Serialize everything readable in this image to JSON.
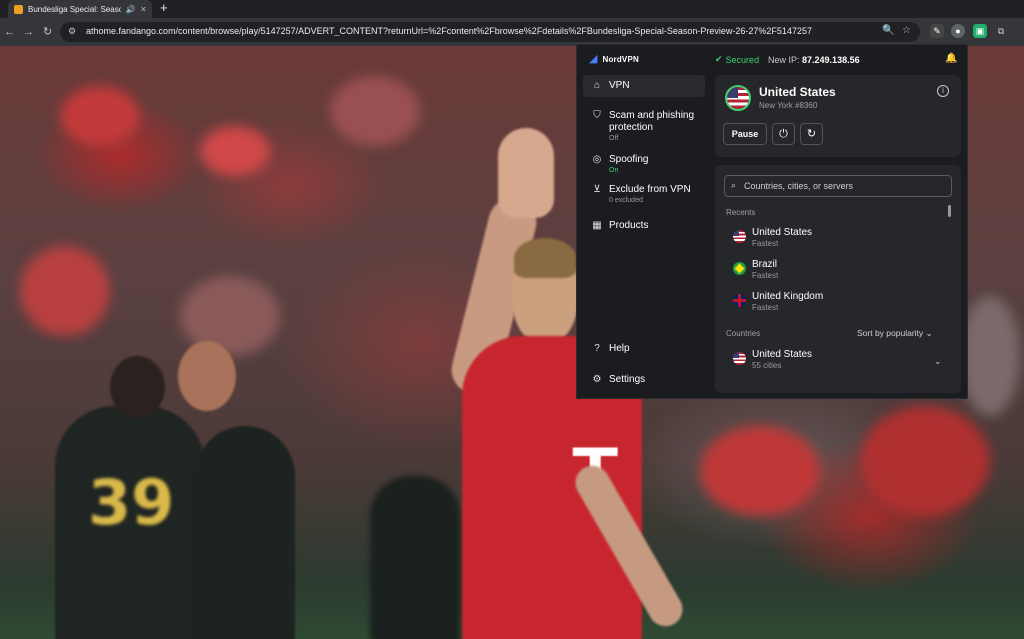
{
  "browser": {
    "tab_title": "Bundesliga Special: Season",
    "tab_audio_icon": "speaker-icon",
    "tab_close": "×",
    "new_tab": "+",
    "back": "←",
    "forward": "→",
    "reload": "↻",
    "url": "athome.fandango.com/content/browse/play/5147257/ADVERT_CONTENT?returnUrl=%2Fcontent%2Fbrowse%2Fdetails%2FBundesliga-Special-Season-Preview-26-27%2F5147257"
  },
  "vpn": {
    "logo_text": "NordVPN",
    "status": "Secured",
    "new_ip_label": "New IP:",
    "new_ip": "87.249.138.56",
    "nav": [
      {
        "label": "VPN",
        "sub": ""
      },
      {
        "label": "Scam and phishing protection",
        "sub": "Off"
      },
      {
        "label": "Spoofing",
        "sub": "On"
      },
      {
        "label": "Exclude from VPN",
        "sub": "0 excluded"
      },
      {
        "label": "Products",
        "sub": ""
      }
    ],
    "help": "Help",
    "settings": "Settings",
    "connection": {
      "country": "United States",
      "server": "New York #8360",
      "pause_label": "Pause"
    },
    "search_placeholder": "Countries, cities, or servers",
    "recents_label": "Recents",
    "recents": [
      {
        "name": "United States",
        "sub": "Fastest"
      },
      {
        "name": "Brazil",
        "sub": "Fastest"
      },
      {
        "name": "United Kingdom",
        "sub": "Fastest"
      }
    ],
    "countries_label": "Countries",
    "sort_label": "Sort by popularity",
    "countries": [
      {
        "name": "United States",
        "sub": "55 cities"
      }
    ],
    "colors": {
      "accent": "#4b7cf6",
      "secured": "#3bd16f",
      "panel": "#1b1c1f"
    }
  }
}
